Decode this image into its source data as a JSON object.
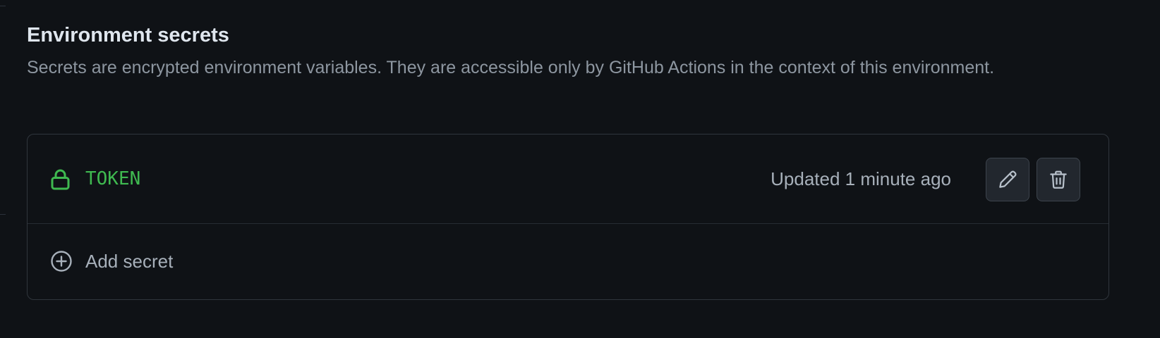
{
  "section": {
    "title": "Environment secrets",
    "description": "Secrets are encrypted environment variables. They are accessible only by GitHub Actions in the context of this environment."
  },
  "secrets": [
    {
      "name": "TOKEN",
      "icon": "lock-icon",
      "updated": "Updated 1 minute ago",
      "actions": {
        "edit_icon": "pencil-icon",
        "delete_icon": "trash-icon"
      }
    }
  ],
  "add_secret": {
    "label": "Add secret",
    "icon": "plus-circle-icon"
  },
  "colors": {
    "background": "#0f1216",
    "secret_name": "#3fb950",
    "border": "#30363d",
    "muted_text": "#8d96a0",
    "title_text": "#dfe6ee"
  }
}
